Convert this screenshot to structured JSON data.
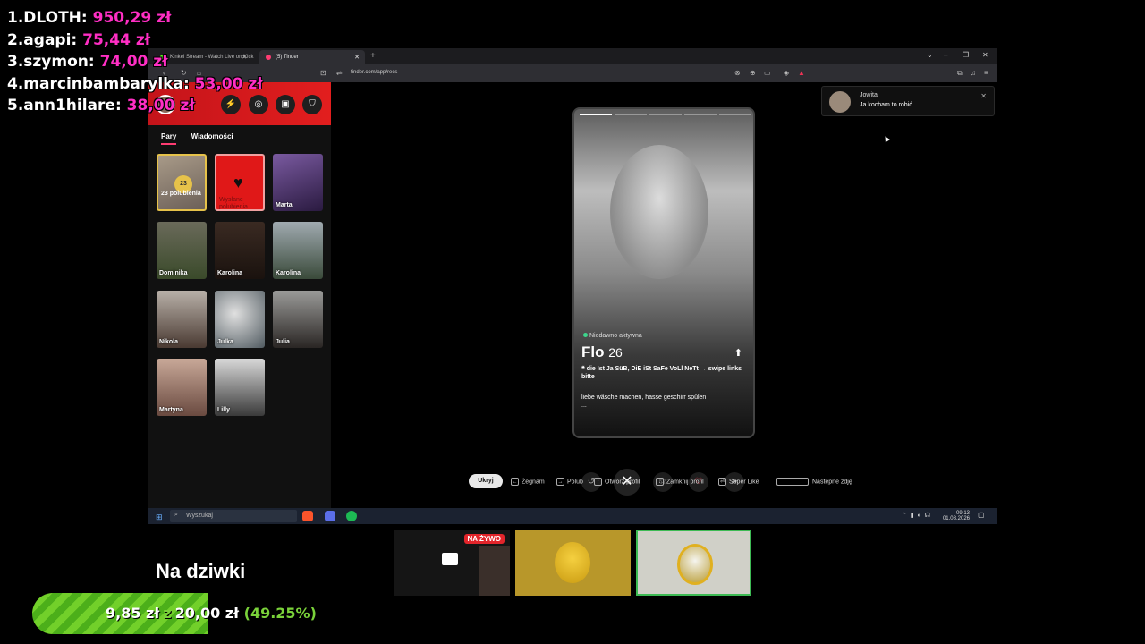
{
  "leaderboard": [
    {
      "rank": "1.",
      "name": "DLOTH:",
      "amount": "950,29 zł"
    },
    {
      "rank": "2.",
      "name": "agapi:",
      "amount": "75,44 zł"
    },
    {
      "rank": "3.",
      "name": "szymon:",
      "amount": "74,00 zł"
    },
    {
      "rank": "4.",
      "name": "marcinbambarylka:",
      "amount": "53,00 zł"
    },
    {
      "rank": "5.",
      "name": "ann1hilare:",
      "amount": "38,00 zł"
    }
  ],
  "browser": {
    "tabs": [
      {
        "label": "Kinkei Stream - Watch Live on Kick"
      },
      {
        "label": "(5) Tinder"
      }
    ],
    "url": "tinder.com/app/recs"
  },
  "sidebar": {
    "tabs": [
      "Pary",
      "Wiadomości"
    ],
    "likes_count": "23",
    "likes_label": "23 polubienia",
    "sent_label": "Wysłane polubienia",
    "matches": [
      "Marta",
      "Dominika",
      "Karolina",
      "Karolina",
      "Nikola",
      "Julka",
      "Julia",
      "Martyna",
      "Lilly"
    ]
  },
  "profile": {
    "status": "Niedawno aktywna",
    "name": "Flo",
    "age": "26",
    "quote": "❝ die Ist Ja SüB, DiE iSt SaFe VoLl NeTt → swipe links bitte",
    "bio": "liebe wäsche machen, hasse geschirr spülen",
    "bio_more": "..."
  },
  "notification": {
    "name": "Jowita",
    "message": "Ja kocham to robić"
  },
  "hints": {
    "hide": "Ukryj",
    "nope": "Żegnam",
    "like": "Polub",
    "open": "Otwórz profil",
    "close": "Zamknij profil",
    "superlike": "Super Like",
    "next_photo": "Następne zdję"
  },
  "taskbar": {
    "search_placeholder": "Wyszukaj",
    "time": "09:13",
    "date": "01.08.2026"
  },
  "goal": {
    "title": "Na dziwki",
    "current": "9,85 zł",
    "connector": "z",
    "target": "20,00 zł",
    "percent_text": "(49.25%)",
    "progress": 0.4925
  },
  "cams": {
    "live_badge": "NA ŻYWO"
  }
}
